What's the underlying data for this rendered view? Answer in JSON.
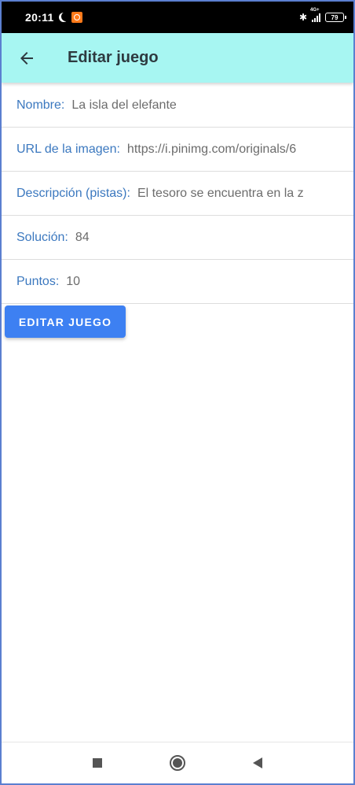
{
  "status_bar": {
    "time": "20:11",
    "network": "4G+",
    "battery": "79"
  },
  "app_bar": {
    "title": "Editar juego",
    "back_icon": "arrow-back-icon"
  },
  "form": {
    "fields": [
      {
        "label": "Nombre:",
        "value": "La isla del elefante"
      },
      {
        "label": "URL de la imagen:",
        "value": "https://i.pinimg.com/originals/6"
      },
      {
        "label": "Descripción (pistas):",
        "value": "El tesoro se encuentra en la z"
      },
      {
        "label": "Solución:",
        "value": "84"
      },
      {
        "label": "Puntos:",
        "value": "10"
      }
    ],
    "submit_label": "EDITAR JUEGO"
  },
  "nav_bar": {
    "icons": [
      "recents-square-icon",
      "home-circle-icon",
      "back-triangle-icon"
    ]
  },
  "colors": {
    "app_bar": "#a7f6f2",
    "label": "#3b78bf",
    "button": "#3d80f2",
    "frame_border": "#5b7fd0"
  }
}
